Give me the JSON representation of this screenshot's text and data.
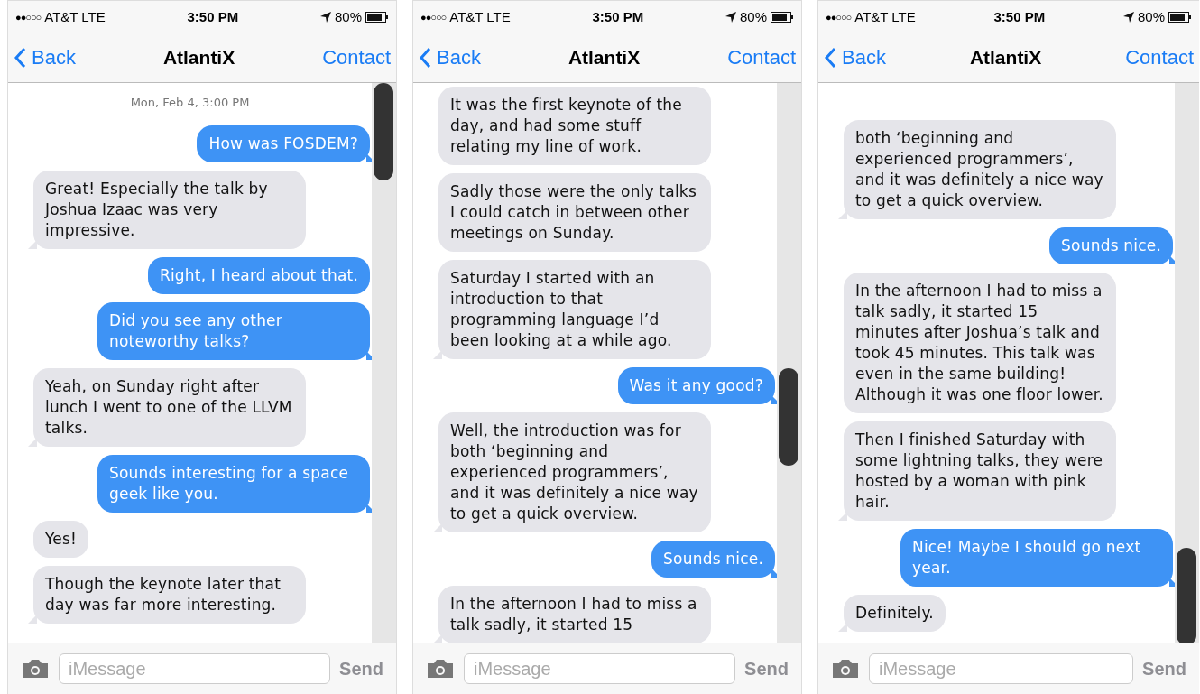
{
  "screens": [
    {
      "status": {
        "signal": "●●○○○",
        "carrier": "AT&T LTE",
        "time": "3:50 PM",
        "battery": "80%"
      },
      "nav": {
        "back": "Back",
        "title": "AtlantiX",
        "action": "Contact"
      },
      "timestamp": "Mon, Feb 4, 3:00 PM",
      "messages": [
        {
          "kind": "sent",
          "text": "How was FOSDEM?"
        },
        {
          "kind": "received",
          "text": "Great! Especially the talk by Joshua Izaac was very impressive."
        },
        {
          "kind": "sent",
          "text": "Right, I heard about that."
        },
        {
          "kind": "sent",
          "text": "Did you see any other noteworthy talks?"
        },
        {
          "kind": "received",
          "text": "Yeah, on Sunday right after lunch I went to one of the LLVM talks."
        },
        {
          "kind": "sent",
          "text": "Sounds interesting for a space geek like you."
        },
        {
          "kind": "received",
          "text": "Yes!"
        },
        {
          "kind": "received",
          "text": "Though the keynote later that day was far more interesting."
        }
      ],
      "input": {
        "placeholder": "iMessage",
        "send": "Send"
      }
    },
    {
      "status": {
        "signal": "●●○○○",
        "carrier": "AT&T LTE",
        "time": "3:50 PM",
        "battery": "80%"
      },
      "nav": {
        "back": "Back",
        "title": "AtlantiX",
        "action": "Contact"
      },
      "messages": [
        {
          "kind": "received",
          "text": "It was the first keynote of the day, and had some stuff relating my line of work."
        },
        {
          "kind": "received",
          "text": "Sadly those were the only talks I could catch in between other meetings on Sunday."
        },
        {
          "kind": "received",
          "text": "Saturday I started with an introduction to that programming language I’d been looking at a while ago."
        },
        {
          "kind": "sent",
          "text": "Was it any good?"
        },
        {
          "kind": "received",
          "text": "Well, the introduction was for both ‘beginning and experienced programmers’, and it was definitely a nice way to get a quick overview."
        },
        {
          "kind": "sent",
          "text": "Sounds nice."
        },
        {
          "kind": "received",
          "text": "In the afternoon I had to miss a talk sadly, it started 15"
        }
      ],
      "input": {
        "placeholder": "iMessage",
        "send": "Send"
      }
    },
    {
      "status": {
        "signal": "●●○○○",
        "carrier": "AT&T LTE",
        "time": "3:50 PM",
        "battery": "80%"
      },
      "nav": {
        "back": "Back",
        "title": "AtlantiX",
        "action": "Contact"
      },
      "messages": [
        {
          "kind": "received",
          "text": "both ‘beginning and experienced programmers’, and it was definitely a nice way to get a quick overview."
        },
        {
          "kind": "sent",
          "text": "Sounds nice."
        },
        {
          "kind": "received",
          "text": "In the afternoon I had to miss a talk sadly, it started 15 minutes after Joshua’s talk and took 45 minutes. This talk was even in the same building! Although it was one floor lower."
        },
        {
          "kind": "received",
          "text": "Then I finished Saturday with some lightning talks, they were hosted by a woman with pink hair."
        },
        {
          "kind": "sent",
          "text": "Nice! Maybe I should go next year."
        },
        {
          "kind": "received",
          "text": "Definitely."
        }
      ],
      "input": {
        "placeholder": "iMessage",
        "send": "Send"
      }
    }
  ]
}
